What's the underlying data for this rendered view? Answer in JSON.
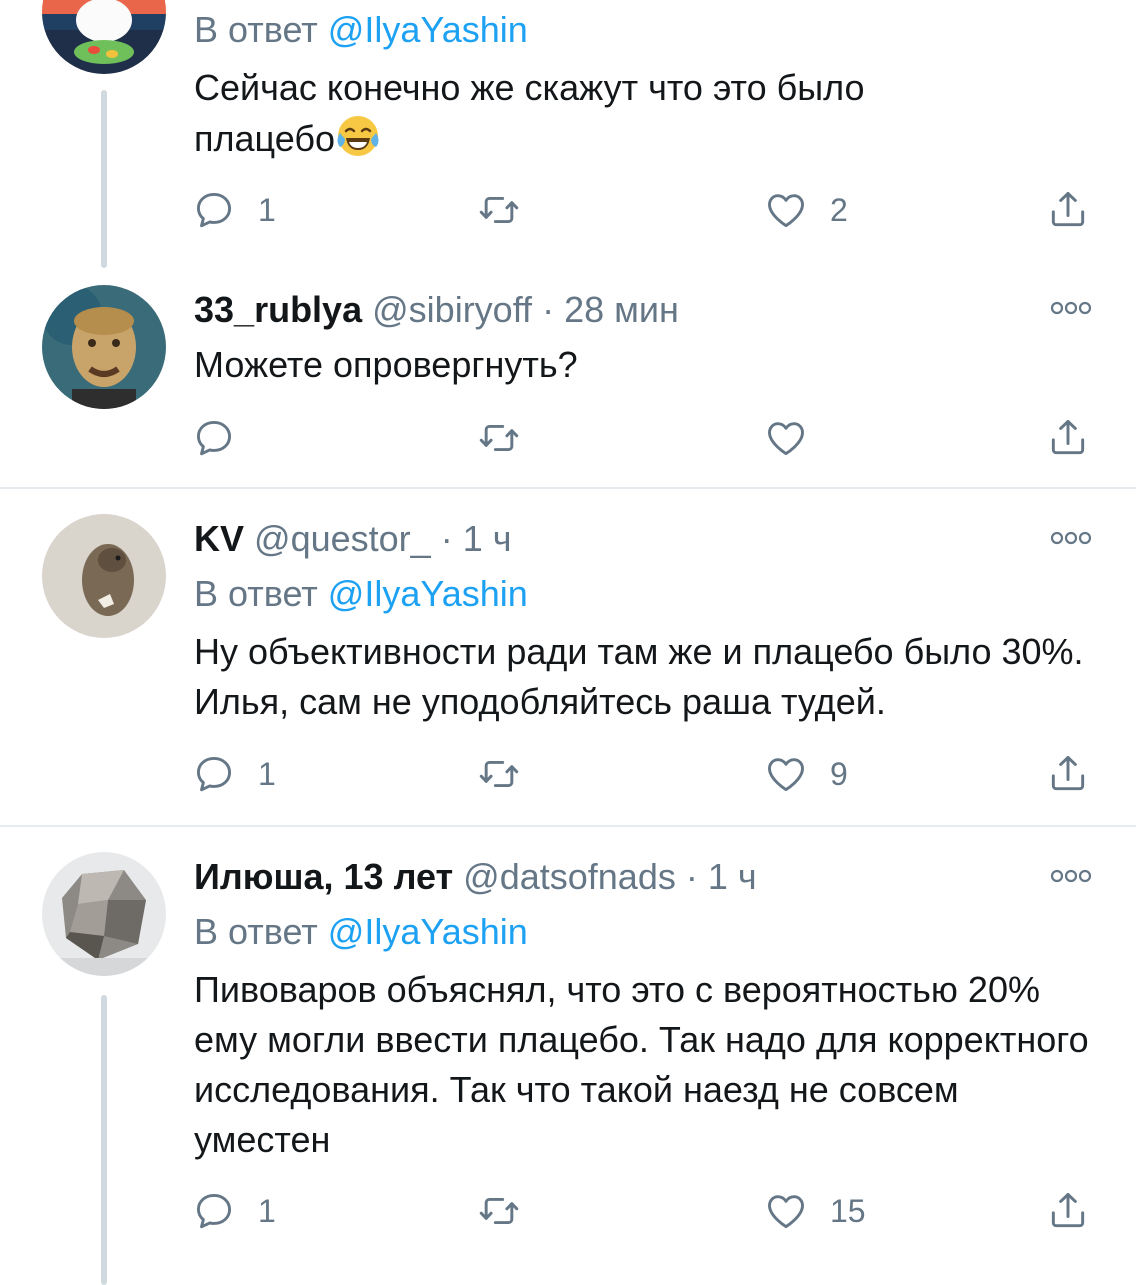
{
  "tweets": [
    {
      "reply_prefix": "В ответ",
      "reply_mention": "@IlyaYashin",
      "text": "Сейчас конечно же скажут что это было плацебо",
      "emoji": "face-with-tears-of-joy",
      "reply_count": "1",
      "retweet_count": "",
      "like_count": "2"
    },
    {
      "name": "33_rublya",
      "handle": "@sibiryoff",
      "separator": "·",
      "time": "28 мин",
      "text": "Можете опровергнуть?",
      "reply_count": "",
      "retweet_count": "",
      "like_count": ""
    },
    {
      "name": "KV",
      "handle": "@questor_",
      "separator": "·",
      "time": "1 ч",
      "reply_prefix": "В ответ",
      "reply_mention": "@IlyaYashin",
      "text": "Ну объективности ради там же и плацебо было 30%. Илья, сам не уподобляйтесь раша тудей.",
      "reply_count": "1",
      "retweet_count": "",
      "like_count": "9"
    },
    {
      "name": "Илюша, 13 лет",
      "handle": "@datsofnads",
      "separator": "·",
      "time": "1 ч",
      "reply_prefix": "В ответ",
      "reply_mention": "@IlyaYashin",
      "text": "Пивоваров объяснял, что это с вероятностью 20% ему могли ввести плацебо. Так надо для корректного исследования. Так что такой наезд не совсем уместен",
      "reply_count": "1",
      "retweet_count": "",
      "like_count": "15"
    }
  ],
  "colors": {
    "text": "#14171a",
    "secondary": "#657786",
    "link": "#1da1f2",
    "thread_line": "#cfd9de",
    "divider": "#e6ecf0"
  },
  "icons": [
    "reply-icon",
    "retweet-icon",
    "like-icon",
    "share-icon",
    "more-icon"
  ]
}
